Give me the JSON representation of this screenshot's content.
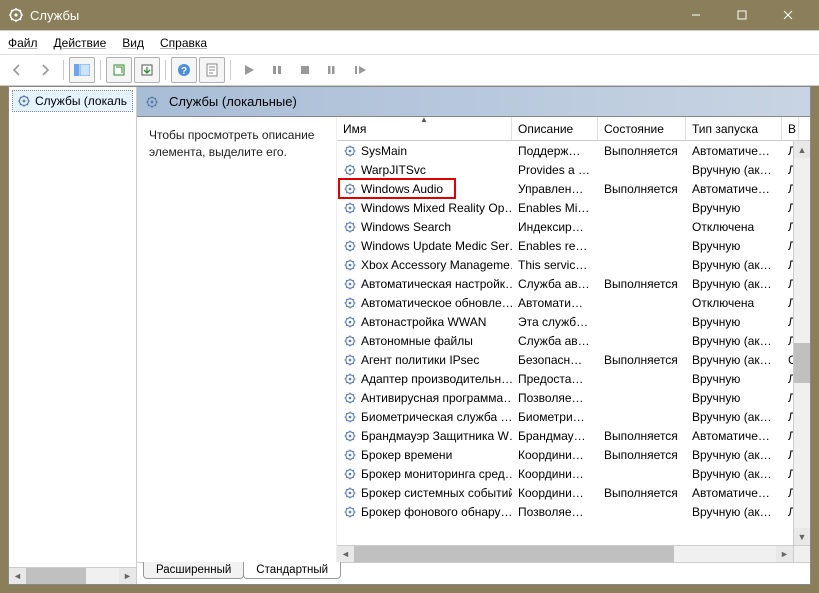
{
  "titlebar": {
    "title": "Службы"
  },
  "menubar": {
    "file": "Файл",
    "action": "Действие",
    "view": "Вид",
    "help": "Справка"
  },
  "tree": {
    "root": "Службы (локаль"
  },
  "pane_header": "Службы (локальные)",
  "info_panel": {
    "text": "Чтобы просмотреть описание элемента, выделите его."
  },
  "columns": {
    "name": "Имя",
    "desc": "Описание",
    "state": "Состояние",
    "startup": "Тип запуска",
    "logon": "В"
  },
  "col_widths": {
    "name": 175,
    "desc": 86,
    "state": 88,
    "startup": 96,
    "logon": 17
  },
  "services": [
    {
      "name": "SysMain",
      "desc": "Поддерж…",
      "state": "Выполняется",
      "startup": "Автоматиче…",
      "logon": "Л"
    },
    {
      "name": "WarpJITSvc",
      "desc": "Provides a …",
      "state": "",
      "startup": "Вручную (ак…",
      "logon": "Л"
    },
    {
      "name": "Windows Audio",
      "desc": "Управлен…",
      "state": "Выполняется",
      "startup": "Автоматиче…",
      "logon": "Л",
      "highlight": true
    },
    {
      "name": "Windows Mixed Reality Op…",
      "desc": "Enables Mi…",
      "state": "",
      "startup": "Вручную",
      "logon": "Л"
    },
    {
      "name": "Windows Search",
      "desc": "Индексир…",
      "state": "",
      "startup": "Отключена",
      "logon": "Л"
    },
    {
      "name": "Windows Update Medic Ser…",
      "desc": "Enables re…",
      "state": "",
      "startup": "Вручную",
      "logon": "Л"
    },
    {
      "name": "Xbox Accessory Manageme…",
      "desc": "This servic…",
      "state": "",
      "startup": "Вручную (ак…",
      "logon": "Л"
    },
    {
      "name": "Автоматическая настройк…",
      "desc": "Служба ав…",
      "state": "Выполняется",
      "startup": "Вручную (ак…",
      "logon": "Л"
    },
    {
      "name": "Автоматическое обновле…",
      "desc": "Автомати…",
      "state": "",
      "startup": "Отключена",
      "logon": "Л"
    },
    {
      "name": "Автонастройка WWAN",
      "desc": "Эта служб…",
      "state": "",
      "startup": "Вручную",
      "logon": "Л"
    },
    {
      "name": "Автономные файлы",
      "desc": "Служба ав…",
      "state": "",
      "startup": "Вручную (ак…",
      "logon": "Л"
    },
    {
      "name": "Агент политики IPsec",
      "desc": "Безопасн…",
      "state": "Выполняется",
      "startup": "Вручную (ак…",
      "logon": "С"
    },
    {
      "name": "Адаптер производительн…",
      "desc": "Предоста…",
      "state": "",
      "startup": "Вручную",
      "logon": "Л"
    },
    {
      "name": "Антивирусная программа…",
      "desc": "Позволяе…",
      "state": "",
      "startup": "Вручную",
      "logon": "Л"
    },
    {
      "name": "Биометрическая служба …",
      "desc": "Биометри…",
      "state": "",
      "startup": "Вручную (ак…",
      "logon": "Л"
    },
    {
      "name": "Брандмауэр Защитника W…",
      "desc": "Брандмау…",
      "state": "Выполняется",
      "startup": "Автоматиче…",
      "logon": "Л"
    },
    {
      "name": "Брокер времени",
      "desc": "Координи…",
      "state": "Выполняется",
      "startup": "Вручную (ак…",
      "logon": "Л"
    },
    {
      "name": "Брокер мониторинга сред…",
      "desc": "Координи…",
      "state": "",
      "startup": "Вручную (ак…",
      "logon": "Л"
    },
    {
      "name": "Брокер системных событий",
      "desc": "Координи…",
      "state": "Выполняется",
      "startup": "Автоматиче…",
      "logon": "Л"
    },
    {
      "name": "Брокер фонового обнару…",
      "desc": "Позволяе…",
      "state": "",
      "startup": "Вручную (ак…",
      "logon": "Л"
    }
  ],
  "tabs": {
    "extended": "Расширенный",
    "standard": "Стандартный"
  }
}
